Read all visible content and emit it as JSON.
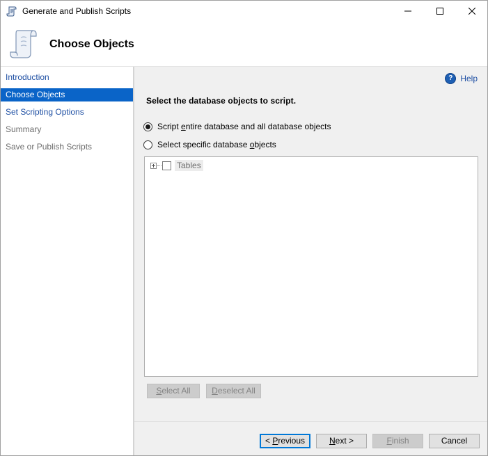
{
  "window": {
    "title": "Generate and Publish Scripts"
  },
  "header": {
    "heading": "Choose Objects"
  },
  "nav": {
    "items": [
      {
        "label": "Introduction",
        "state": "link"
      },
      {
        "label": "Choose Objects",
        "state": "selected"
      },
      {
        "label": "Set Scripting Options",
        "state": "link"
      },
      {
        "label": "Summary",
        "state": "disabled"
      },
      {
        "label": "Save or Publish Scripts",
        "state": "disabled"
      }
    ]
  },
  "main": {
    "help_label": "Help",
    "prompt": "Select the database objects to script.",
    "options": [
      {
        "pre": "Script ",
        "accel": "e",
        "post": "ntire database and all database objects",
        "checked": true
      },
      {
        "pre": "Select specific database ",
        "accel": "o",
        "post": "bjects",
        "checked": false
      }
    ],
    "tree": {
      "nodes": [
        {
          "label": "Tables",
          "checked": false,
          "expanded": false
        }
      ]
    },
    "select_all": {
      "accel": "S",
      "rest": "elect All"
    },
    "deselect_all": {
      "accel": "D",
      "rest": "eselect All"
    }
  },
  "footer": {
    "previous": {
      "pre": "< ",
      "accel": "P",
      "post": "revious"
    },
    "next": {
      "accel": "N",
      "post": "ext >"
    },
    "finish": {
      "accel": "F",
      "post": "inish"
    },
    "cancel": "Cancel"
  },
  "colors": {
    "selection": "#0a64c8",
    "link": "#1e4fa3",
    "panel": "#f0f0f0"
  }
}
